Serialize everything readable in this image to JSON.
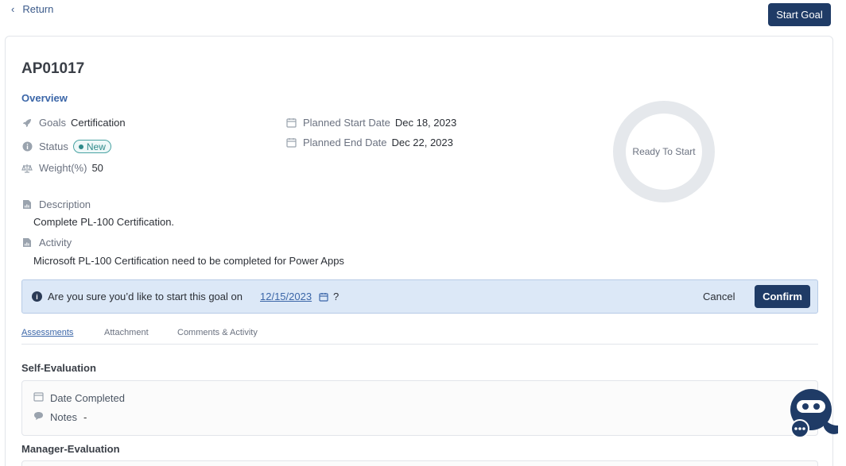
{
  "nav": {
    "return_label": "Return",
    "start_goal_label": "Start Goal"
  },
  "goal": {
    "id": "AP01017",
    "overview_label": "Overview",
    "goals": {
      "label": "Goals",
      "value": "Certification"
    },
    "status": {
      "label": "Status",
      "value": "New"
    },
    "weight": {
      "label": "Weight(%)",
      "value": "50"
    },
    "planned_start": {
      "label": "Planned Start Date",
      "value": "Dec 18, 2023"
    },
    "planned_end": {
      "label": "Planned End Date",
      "value": "Dec 22, 2023"
    },
    "progress_label": "Ready To Start",
    "description": {
      "label": "Description",
      "value": "Complete PL-100 Certification."
    },
    "activity": {
      "label": "Activity",
      "value": "Microsoft PL-100 Certification need to be completed for Power Apps"
    }
  },
  "confirm_bar": {
    "question": "Are you sure you’d like to start this goal on",
    "date": "12/15/2023",
    "qmark": "?",
    "cancel_label": "Cancel",
    "confirm_label": "Confirm"
  },
  "tabs": [
    {
      "label": "Assessments",
      "active": true
    },
    {
      "label": "Attachment",
      "active": false
    },
    {
      "label": "Comments & Activity",
      "active": false
    }
  ],
  "self_evaluation": {
    "title": "Self-Evaluation",
    "date_completed_label": "Date Completed",
    "notes_label": "Notes",
    "notes_value": "-"
  },
  "manager_evaluation": {
    "title": "Manager-Evaluation"
  },
  "colors": {
    "primary": "#1f3b66",
    "accent": "#3b66a8",
    "status_new": "#2f8a8a",
    "banner_bg": "#dce8f7"
  },
  "icons": [
    "chevron-left-icon",
    "rocket-icon",
    "info-icon",
    "scale-icon",
    "calendar-icon",
    "document-icon",
    "comment-icon",
    "chatbot-icon"
  ]
}
